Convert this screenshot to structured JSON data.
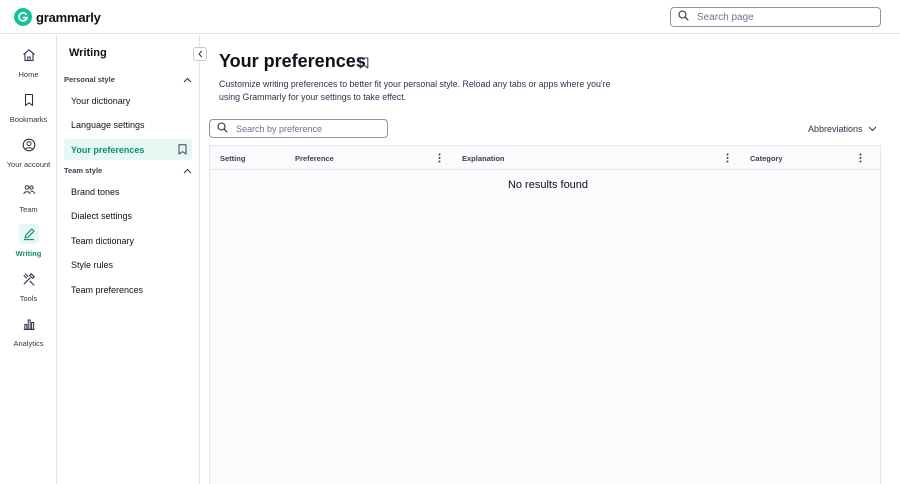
{
  "app": {
    "brand": "grammarly"
  },
  "top_search": {
    "placeholder": "Search page"
  },
  "rail": {
    "items": [
      {
        "label": "Home",
        "icon": "home-icon",
        "active": false
      },
      {
        "label": "Bookmarks",
        "icon": "bookmark-icon",
        "active": false
      },
      {
        "label": "Your account",
        "icon": "account-icon",
        "active": false
      },
      {
        "label": "Team",
        "icon": "team-icon",
        "active": false
      },
      {
        "label": "Writing",
        "icon": "pen-icon",
        "active": true
      },
      {
        "label": "Tools",
        "icon": "tools-icon",
        "active": false
      },
      {
        "label": "Analytics",
        "icon": "analytics-icon",
        "active": false
      }
    ]
  },
  "sidebar": {
    "title": "Writing",
    "sections": [
      {
        "label": "Personal style",
        "items": [
          {
            "label": "Your dictionary"
          },
          {
            "label": "Language settings"
          },
          {
            "label": "Your preferences",
            "active": true
          }
        ]
      },
      {
        "label": "Team style",
        "items": [
          {
            "label": "Brand tones"
          },
          {
            "label": "Dialect settings"
          },
          {
            "label": "Team dictionary"
          },
          {
            "label": "Style rules"
          },
          {
            "label": "Team preferences"
          }
        ]
      }
    ]
  },
  "main": {
    "title": "Your preferences",
    "description": "Customize writing preferences to better fit your personal style. Reload any tabs or apps where you're using Grammarly for your settings to take effect.",
    "search_placeholder": "Search by preference",
    "filter_label": "Abbreviations",
    "table": {
      "columns": [
        "Setting",
        "Preference",
        "Explanation",
        "Category"
      ],
      "empty_message": "No results found"
    }
  },
  "colors": {
    "accent": "#15c39a",
    "accent_text": "#0c8f70",
    "active_bg": "#e6f8f3",
    "border": "#e4e6eb"
  }
}
